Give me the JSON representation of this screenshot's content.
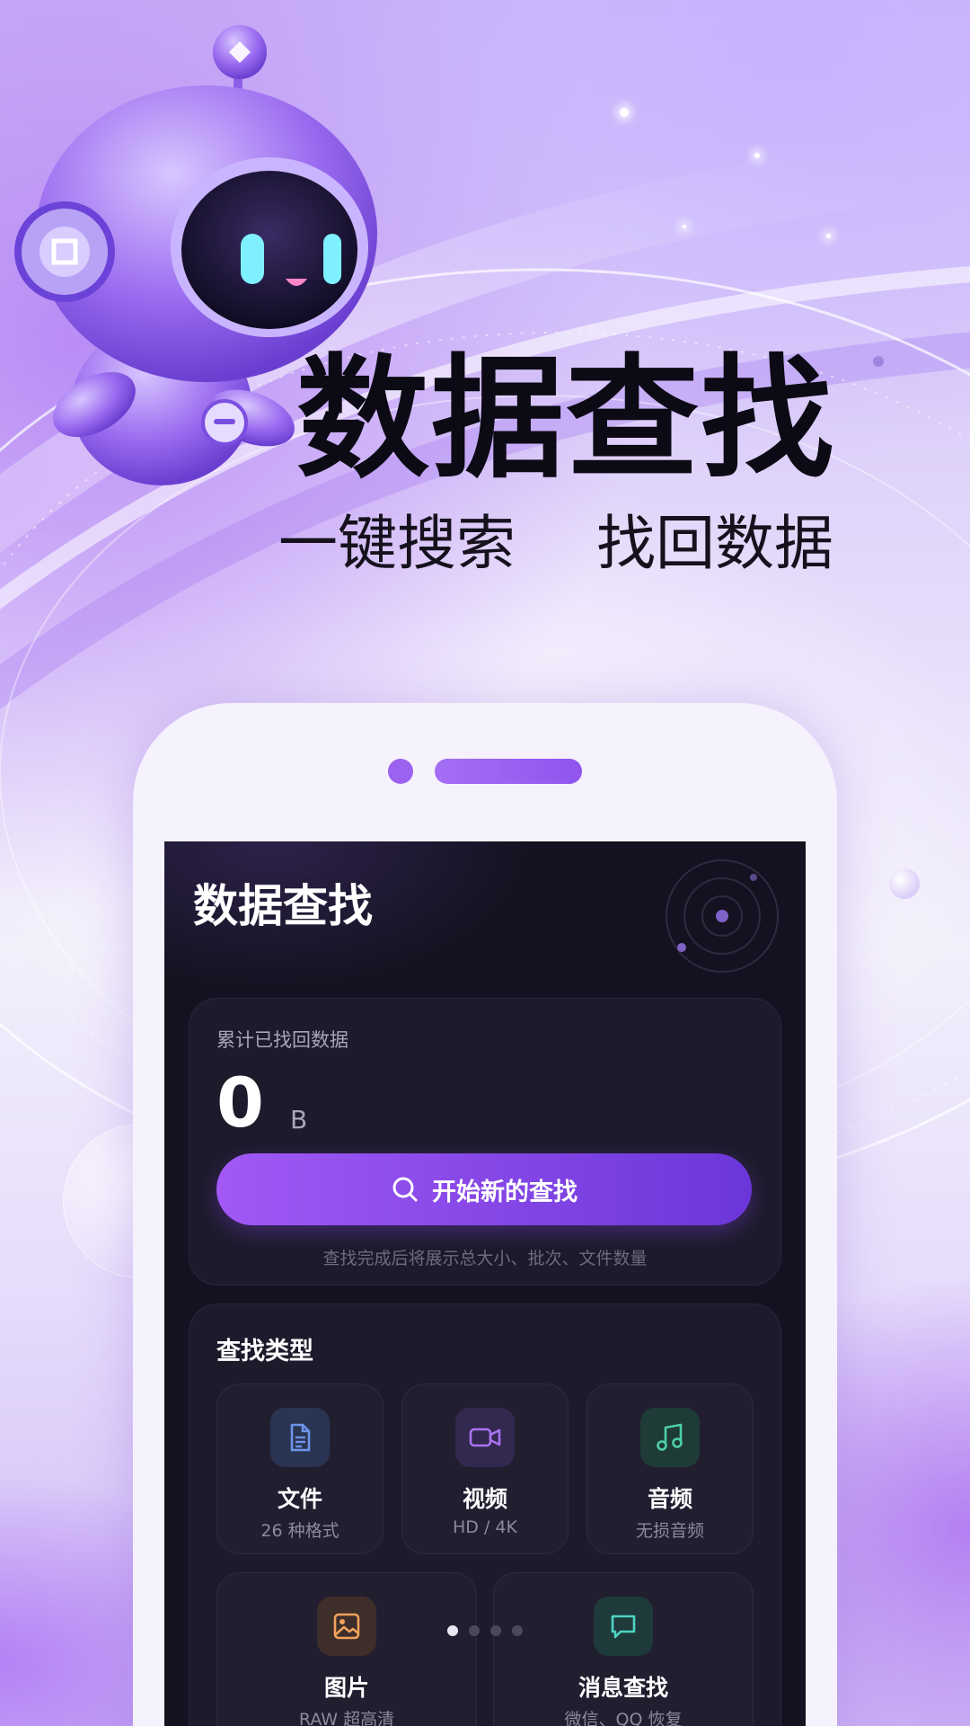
{
  "hero": {
    "title": "数据查找",
    "subtitle_left": "一键搜索",
    "subtitle_right": "找回数据"
  },
  "app": {
    "title": "数据查找",
    "stats": {
      "label": "累计已找回数据",
      "value": "0",
      "unit": "B",
      "button_label": "开始新的查找",
      "hint": "查找完成后将展示总大小、批次、文件数量"
    },
    "types": {
      "title": "查找类型",
      "items": [
        {
          "title": "文件",
          "subtitle": "26 种格式",
          "icon": "document-icon",
          "color": "#6e93e8"
        },
        {
          "title": "视频",
          "subtitle": "HD / 4K",
          "icon": "video-icon",
          "color": "#a774f0"
        },
        {
          "title": "音频",
          "subtitle": "无损音频",
          "icon": "music-note-icon",
          "color": "#4ecfa8"
        },
        {
          "title": "图片",
          "subtitle": "RAW 超高清",
          "icon": "image-icon",
          "color": "#f0a25c"
        },
        {
          "title": "消息查找",
          "subtitle": "微信、QQ 恢复",
          "icon": "chat-bubble-icon",
          "color": "#4fd3c4"
        }
      ]
    },
    "pager": {
      "count": 4,
      "active": 1
    }
  },
  "colors": {
    "accent": "#8f55ee",
    "screen_bg": "#141220",
    "card_bg": "#1d1a2b"
  }
}
